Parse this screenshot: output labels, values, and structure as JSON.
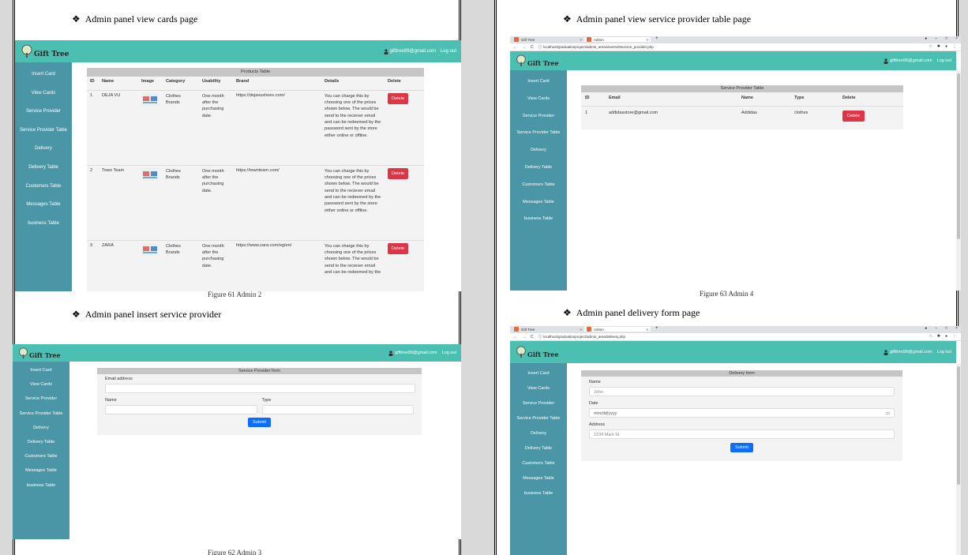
{
  "left": {
    "h1": "Admin panel view cards page",
    "cap1": "Figure 61 Admin 2",
    "h2": "Admin panel insert service provider",
    "cap2": "Figure 62 Admin 3"
  },
  "right": {
    "h1": "Admin panel view service provider table page",
    "cap1": "Figure 63 Admin 4",
    "h2": "Admin panel delivery form page"
  },
  "app": {
    "logo": "Gift Tree",
    "email": "gifttree99@gmail.com",
    "logout": "Log out",
    "nav": [
      "Insert Card",
      "View Cards",
      "Service Provider",
      "Service Provider Table",
      "Delivery",
      "Delivery Table",
      "Customers Table",
      "Messages Table",
      "business Table"
    ]
  },
  "browser": {
    "tab1": "Gift Tree",
    "tab2": "Admin",
    "close": "×",
    "newtab": "+",
    "url_sp": "localhost/graduationproject/admin_area/view%20service_provider.php",
    "url_delivery": "localhost/graduationproject/admin_area/delivery.php",
    "info": "ⓘ"
  },
  "products": {
    "title": "Products Table",
    "cols": [
      "ID",
      "Name",
      "Image",
      "Category",
      "Usability",
      "Brand",
      "Details",
      "Delete"
    ],
    "rows": [
      {
        "id": "1",
        "name": "DEJA VU",
        "cat": "Clothes Brands",
        "use": "One month after the purchasing date.",
        "brand": "https://dejavushoes.com/",
        "details": "You can charge this by choosing one of the prices shown below. The would be send to the reciever email and can be redeemed by the password sent by the store either online or offline.",
        "del": "Delete"
      },
      {
        "id": "2",
        "name": "Town Team",
        "cat": "Clothes Brands",
        "use": "One month after the purchasing date.",
        "brand": "https://townteam.com/",
        "details": "You can charge this by choosing one of the prices shown below. The would be send to the reciever email and can be redeemed by the password sent by the store either online or offline.",
        "del": "Delete"
      },
      {
        "id": "3",
        "name": "ZARA",
        "cat": "Clothes Brands",
        "use": "One month after the purchasing date.",
        "brand": "https://www.zara.com/eg/en/",
        "details": "You can charge this by choosing one of the prices shown below. The would be send to the reciever email and can be redeemed by the",
        "del": "Delete"
      }
    ]
  },
  "sp_form": {
    "title": "Service Provider form",
    "email_label": "Email address",
    "name_label": "Name",
    "type_label": "Type",
    "submit": "Submit"
  },
  "sp_table": {
    "title": "Service Provider Table",
    "cols": [
      "ID",
      "Email",
      "Name",
      "Type",
      "Delete"
    ],
    "rows": [
      {
        "id": "1",
        "email": "addidasstore@gmail.com",
        "name": "Addidas",
        "type": "clothes",
        "del": "Delete"
      }
    ]
  },
  "delivery": {
    "title": "Delivery form",
    "name_label": "Name",
    "name_ph": "John",
    "date_label": "Date",
    "date_ph": "mm/dd/yyyy",
    "address_label": "Address",
    "address_ph": "1234 Main St",
    "submit": "Submit"
  }
}
